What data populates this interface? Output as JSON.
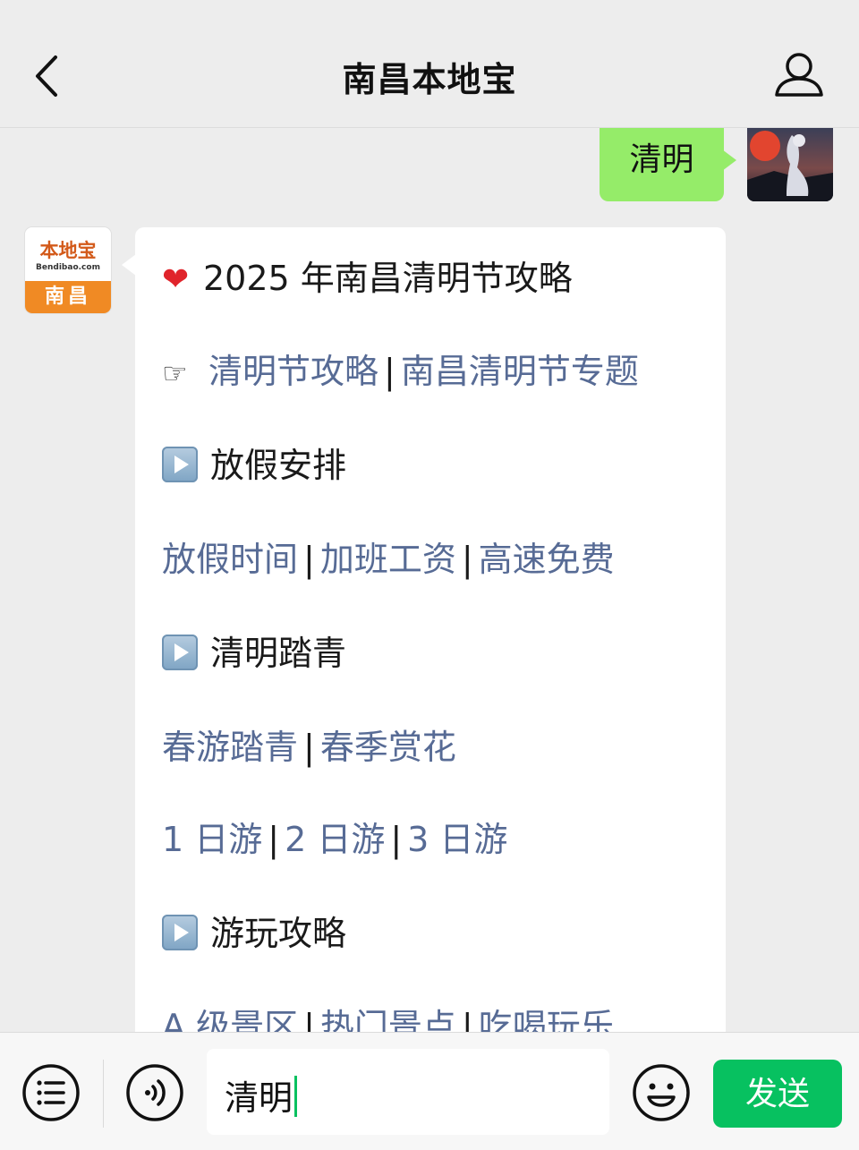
{
  "header": {
    "title": "南昌本地宝",
    "back_icon": "chevron-left-icon",
    "profile_icon": "person-icon"
  },
  "chat": {
    "outgoing": {
      "text": "清明"
    },
    "bot_avatar": {
      "logo_text": "本地宝",
      "logo_domain": "Bendibao.com",
      "city": "南昌"
    },
    "reply": {
      "heading": "2025 年南昌清明节攻略",
      "links_row1": [
        "清明节攻略",
        "南昌清明节专题"
      ],
      "section1": "放假安排",
      "links_row2": [
        "放假时间",
        "加班工资",
        "高速免费"
      ],
      "section2": "清明踏青",
      "links_row3": [
        "春游踏青",
        "春季赏花"
      ],
      "links_row4": [
        "1 日游",
        "2 日游",
        "3 日游"
      ],
      "section3": "游玩攻略",
      "links_row5": [
        "A 级景区",
        "热门景点",
        "吃喝玩乐"
      ],
      "separator": "|"
    }
  },
  "input_bar": {
    "value": "清明",
    "send_label": "发送",
    "icons": [
      "list-icon",
      "voice-icon",
      "emoji-icon"
    ]
  },
  "colors": {
    "background": "#ededed",
    "outgoing_bubble": "#95ec69",
    "link": "#576b95",
    "send_button": "#07c160",
    "logo_orange": "#f08a24"
  }
}
